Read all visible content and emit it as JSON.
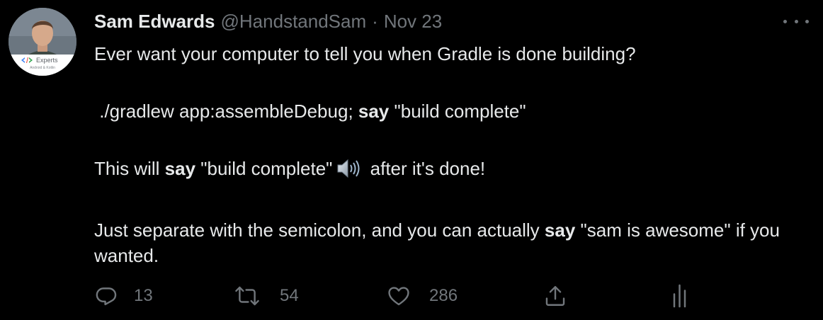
{
  "tweet": {
    "author_name": "Sam Edwards",
    "author_handle": "@HandstandSam",
    "separator": "·",
    "date": "Nov 23",
    "avatar_badge": "Experts",
    "avatar_badge_sub": "Android & Kotlin",
    "line1": "Ever want your computer to tell you when Gradle is done building?",
    "line2_pre": " ./gradlew app:assembleDebug; ",
    "line2_bold": "say",
    "line2_post": " \"build complete\"",
    "line3_pre": "This will ",
    "line3_bold": "say",
    "line3_mid": " \"build complete\"",
    "line3_post": " after it's done!",
    "line4_pre": "Just separate with the semicolon, and you can actually ",
    "line4_bold": "say",
    "line4_post": " \"sam is awesome\" if you wanted.",
    "speaker_icon": "speaker-high-volume-icon"
  },
  "actions": {
    "reply_count": "13",
    "retweet_count": "54",
    "like_count": "286",
    "icons": [
      "reply-icon",
      "retweet-icon",
      "like-icon",
      "share-icon",
      "analytics-icon"
    ]
  },
  "colors": {
    "background": "#000000",
    "text": "#e7e9ea",
    "muted": "#71767b"
  }
}
